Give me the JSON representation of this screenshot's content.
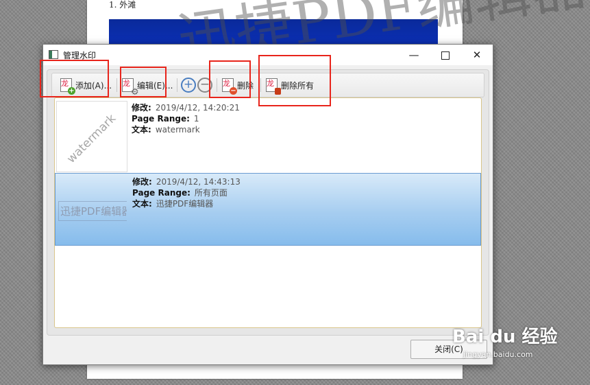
{
  "document": {
    "heading": "1. 外滩",
    "watermark_text": "迅捷PDF编辑器"
  },
  "dialog": {
    "title": "管理水印",
    "minimize": "—",
    "close_glyph": "✕",
    "toolbar": {
      "add_label": "添加(A)...",
      "edit_label": "编辑(E)...",
      "plus": "+",
      "minus": "−",
      "delete_label": "删除",
      "delete_all_label": "删除所有"
    },
    "watermarks": [
      {
        "thumb": "watermark",
        "modified_key": "修改:",
        "modified_value": "2019/4/12, 14:20:21",
        "range_key": "Page Range:",
        "range_value": "1",
        "text_key": "文本:",
        "text_value": "watermark",
        "selected": false
      },
      {
        "thumb": "迅捷PDF编辑器",
        "modified_key": "修改:",
        "modified_value": "2019/4/12, 14:43:13",
        "range_key": "Page Range:",
        "range_value": "所有页面",
        "text_key": "文本:",
        "text_value": "迅捷PDF编辑器",
        "selected": true
      }
    ],
    "close_button": "关闭(C)"
  },
  "overlay": {
    "logo": "Bai  du 经验",
    "url": "jingyan.baidu.com",
    "highlight_color": "#e8241b"
  }
}
